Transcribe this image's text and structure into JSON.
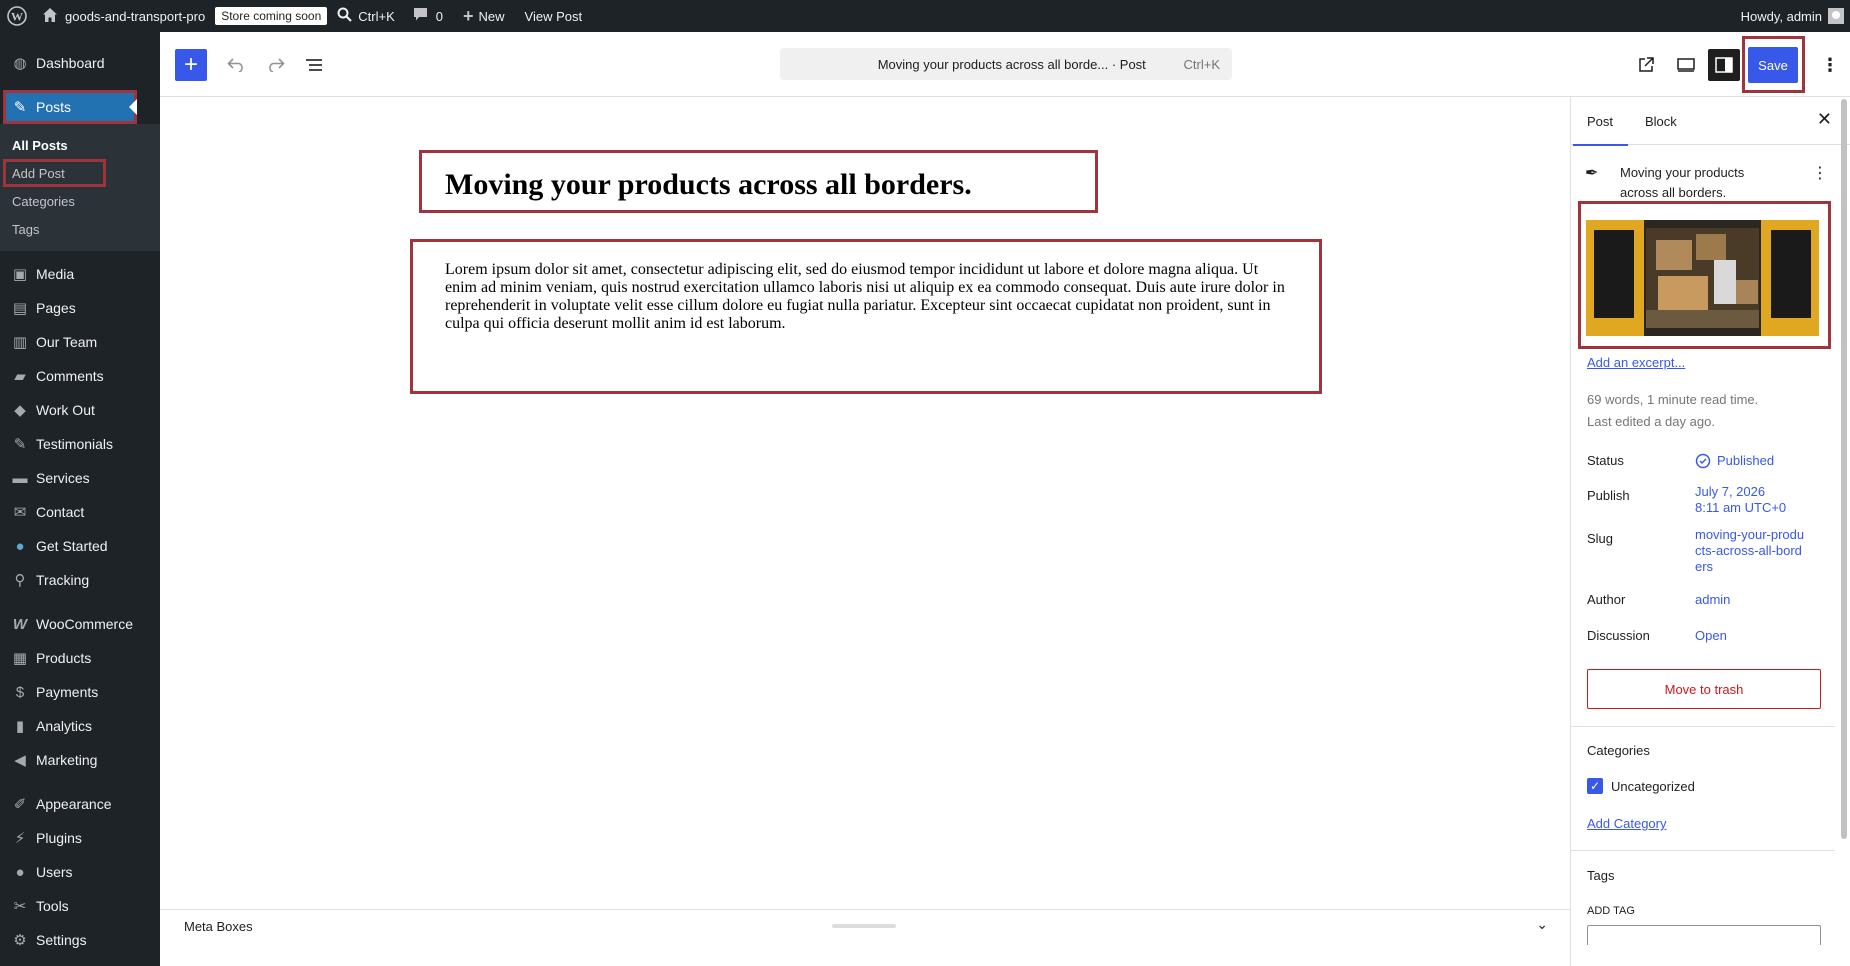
{
  "adminbar": {
    "site_name": "goods-and-transport-pro",
    "store_badge": "Store coming soon",
    "shortcut": "Ctrl+K",
    "comments_count": "0",
    "new_label": "New",
    "view_post": "View Post",
    "howdy": "Howdy, admin"
  },
  "sidebar": {
    "items_top": [
      {
        "label": "Dashboard",
        "icon": "dashboard-icon"
      },
      {
        "label": "Posts",
        "icon": "pin-icon"
      }
    ],
    "submenu": [
      "All Posts",
      "Add Post",
      "Categories",
      "Tags"
    ],
    "items": [
      {
        "label": "Media",
        "icon": "media-icon"
      },
      {
        "label": "Pages",
        "icon": "pages-icon"
      },
      {
        "label": "Our Team",
        "icon": "team-icon"
      },
      {
        "label": "Comments",
        "icon": "comments-icon"
      },
      {
        "label": "Work Out",
        "icon": "tag-icon"
      },
      {
        "label": "Testimonials",
        "icon": "pin-icon"
      },
      {
        "label": "Services",
        "icon": "folder-icon"
      },
      {
        "label": "Contact",
        "icon": "mail-icon"
      },
      {
        "label": "Get Started",
        "icon": "globe-icon"
      },
      {
        "label": "Tracking",
        "icon": "location-icon"
      },
      {
        "label": "WooCommerce",
        "icon": "woo-icon"
      },
      {
        "label": "Products",
        "icon": "archive-icon"
      },
      {
        "label": "Payments",
        "icon": "dollar-icon"
      },
      {
        "label": "Analytics",
        "icon": "chart-icon"
      },
      {
        "label": "Marketing",
        "icon": "megaphone-icon"
      },
      {
        "label": "Appearance",
        "icon": "brush-icon"
      },
      {
        "label": "Plugins",
        "icon": "plug-icon"
      },
      {
        "label": "Users",
        "icon": "user-icon"
      },
      {
        "label": "Tools",
        "icon": "wrench-icon"
      },
      {
        "label": "Settings",
        "icon": "settings-icon"
      }
    ]
  },
  "toolbar": {
    "doc_title": "Moving your products across all borde... · Post",
    "doc_shortcut": "Ctrl+K",
    "save_label": "Save"
  },
  "editor": {
    "title": "Moving your products across all borders.",
    "paragraph": "Lorem ipsum dolor sit amet, consectetur adipiscing elit, sed do eiusmod tempor incididunt ut labore et dolore magna aliqua. Ut enim ad minim veniam, quis nostrud exercitation ullamco laboris nisi ut aliquip ex ea commodo consequat. Duis aute irure dolor in reprehenderit in voluptate velit esse cillum dolore eu fugiat nulla pariatur. Excepteur sint occaecat cupidatat non proident, sunt in culpa qui officia deserunt mollit anim id est laborum."
  },
  "metabox": {
    "label": "Meta Boxes"
  },
  "settings": {
    "tabs": [
      "Post",
      "Block"
    ],
    "post_title": "Moving your products across all borders.",
    "excerpt_link": "Add an excerpt...",
    "word_count": "69 words, 1 minute read time.",
    "last_edited": "Last edited a day ago.",
    "status_label": "Status",
    "status_value": "Published",
    "publish_label": "Publish",
    "publish_date": "July 7, 2026",
    "publish_time": "8:11 am UTC+0",
    "slug_label": "Slug",
    "slug_value": "moving-your-products-across-all-borders",
    "author_label": "Author",
    "author_value": "admin",
    "discussion_label": "Discussion",
    "discussion_value": "Open",
    "trash_label": "Move to trash",
    "categories_title": "Categories",
    "category_name": "Uncategorized",
    "add_category": "Add Category",
    "tags_title": "Tags",
    "add_tag_label": "ADD TAG"
  },
  "colors": {
    "accent": "#3858e9",
    "admin_bg": "#1d2327",
    "highlight": "#a0343c",
    "danger": "#cc1818"
  }
}
